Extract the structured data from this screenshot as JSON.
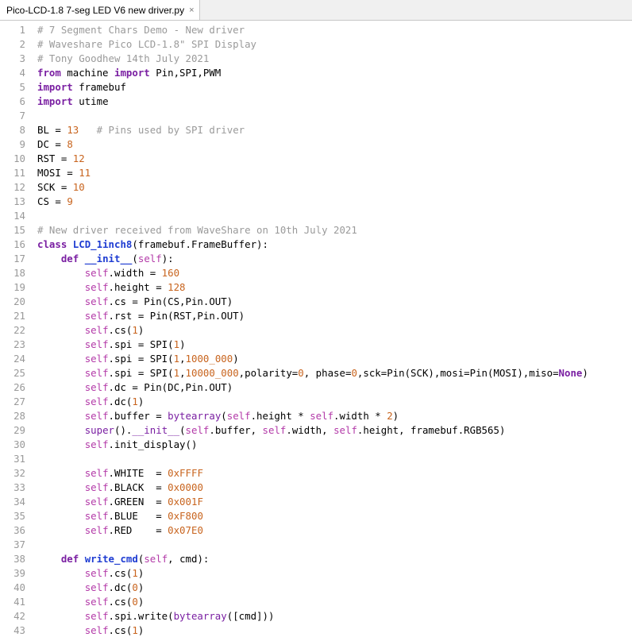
{
  "tab": {
    "title": "Pico-LCD-1.8 7-seg LED V6 new driver.py",
    "close": "×"
  },
  "lines": [
    [
      [
        "c",
        "# 7 Segment Chars Demo - New driver"
      ]
    ],
    [
      [
        "c",
        "# Waveshare Pico LCD-1.8\" SPI Display"
      ]
    ],
    [
      [
        "c",
        "# Tony Goodhew 14th July 2021"
      ]
    ],
    [
      [
        "k",
        "from"
      ],
      [
        "t",
        " machine "
      ],
      [
        "k",
        "import"
      ],
      [
        "t",
        " Pin,SPI,PWM"
      ]
    ],
    [
      [
        "k",
        "import"
      ],
      [
        "t",
        " framebuf"
      ]
    ],
    [
      [
        "k",
        "import"
      ],
      [
        "t",
        " utime"
      ]
    ],
    [],
    [
      [
        "t",
        "BL = "
      ],
      [
        "n",
        "13"
      ],
      [
        "t",
        "   "
      ],
      [
        "c",
        "# Pins used by SPI driver"
      ]
    ],
    [
      [
        "t",
        "DC = "
      ],
      [
        "n",
        "8"
      ]
    ],
    [
      [
        "t",
        "RST = "
      ],
      [
        "n",
        "12"
      ]
    ],
    [
      [
        "t",
        "MOSI = "
      ],
      [
        "n",
        "11"
      ]
    ],
    [
      [
        "t",
        "SCK = "
      ],
      [
        "n",
        "10"
      ]
    ],
    [
      [
        "t",
        "CS = "
      ],
      [
        "n",
        "9"
      ]
    ],
    [],
    [
      [
        "c",
        "# New driver received from WaveShare on 10th July 2021"
      ]
    ],
    [
      [
        "k",
        "class"
      ],
      [
        "t",
        " "
      ],
      [
        "f",
        "LCD_1inch8"
      ],
      [
        "t",
        "(framebuf.FrameBuffer):"
      ]
    ],
    [
      [
        "t",
        "    "
      ],
      [
        "k",
        "def"
      ],
      [
        "t",
        " "
      ],
      [
        "f",
        "__init__"
      ],
      [
        "t",
        "("
      ],
      [
        "s",
        "self"
      ],
      [
        "t",
        "):"
      ]
    ],
    [
      [
        "t",
        "        "
      ],
      [
        "s",
        "self"
      ],
      [
        "t",
        ".width = "
      ],
      [
        "n",
        "160"
      ]
    ],
    [
      [
        "t",
        "        "
      ],
      [
        "s",
        "self"
      ],
      [
        "t",
        ".height = "
      ],
      [
        "n",
        "128"
      ]
    ],
    [
      [
        "t",
        "        "
      ],
      [
        "s",
        "self"
      ],
      [
        "t",
        ".cs = Pin(CS,Pin.OUT)"
      ]
    ],
    [
      [
        "t",
        "        "
      ],
      [
        "s",
        "self"
      ],
      [
        "t",
        ".rst = Pin(RST,Pin.OUT)"
      ]
    ],
    [
      [
        "t",
        "        "
      ],
      [
        "s",
        "self"
      ],
      [
        "t",
        ".cs("
      ],
      [
        "n",
        "1"
      ],
      [
        "t",
        ")"
      ]
    ],
    [
      [
        "t",
        "        "
      ],
      [
        "s",
        "self"
      ],
      [
        "t",
        ".spi = SPI("
      ],
      [
        "n",
        "1"
      ],
      [
        "t",
        ")"
      ]
    ],
    [
      [
        "t",
        "        "
      ],
      [
        "s",
        "self"
      ],
      [
        "t",
        ".spi = SPI("
      ],
      [
        "n",
        "1"
      ],
      [
        "t",
        ","
      ],
      [
        "n",
        "1000_000"
      ],
      [
        "t",
        ")"
      ]
    ],
    [
      [
        "t",
        "        "
      ],
      [
        "s",
        "self"
      ],
      [
        "t",
        ".spi = SPI("
      ],
      [
        "n",
        "1"
      ],
      [
        "t",
        ","
      ],
      [
        "n",
        "10000_000"
      ],
      [
        "t",
        ",polarity="
      ],
      [
        "n",
        "0"
      ],
      [
        "t",
        ", phase="
      ],
      [
        "n",
        "0"
      ],
      [
        "t",
        ",sck=Pin(SCK),mosi=Pin(MOSI),miso="
      ],
      [
        "k",
        "None"
      ],
      [
        "t",
        ")"
      ]
    ],
    [
      [
        "t",
        "        "
      ],
      [
        "s",
        "self"
      ],
      [
        "t",
        ".dc = Pin(DC,Pin.OUT)"
      ]
    ],
    [
      [
        "t",
        "        "
      ],
      [
        "s",
        "self"
      ],
      [
        "t",
        ".dc("
      ],
      [
        "n",
        "1"
      ],
      [
        "t",
        ")"
      ]
    ],
    [
      [
        "t",
        "        "
      ],
      [
        "s",
        "self"
      ],
      [
        "t",
        ".buffer = "
      ],
      [
        "b",
        "bytearray"
      ],
      [
        "t",
        "("
      ],
      [
        "s",
        "self"
      ],
      [
        "t",
        ".height * "
      ],
      [
        "s",
        "self"
      ],
      [
        "t",
        ".width * "
      ],
      [
        "n",
        "2"
      ],
      [
        "t",
        ")"
      ]
    ],
    [
      [
        "t",
        "        "
      ],
      [
        "b",
        "super"
      ],
      [
        "t",
        "()."
      ],
      [
        "b",
        "__init__"
      ],
      [
        "t",
        "("
      ],
      [
        "s",
        "self"
      ],
      [
        "t",
        ".buffer, "
      ],
      [
        "s",
        "self"
      ],
      [
        "t",
        ".width, "
      ],
      [
        "s",
        "self"
      ],
      [
        "t",
        ".height, framebuf.RGB565)"
      ]
    ],
    [
      [
        "t",
        "        "
      ],
      [
        "s",
        "self"
      ],
      [
        "t",
        ".init_display()"
      ]
    ],
    [],
    [
      [
        "t",
        "        "
      ],
      [
        "s",
        "self"
      ],
      [
        "t",
        ".WHITE  = "
      ],
      [
        "n",
        "0xFFFF"
      ]
    ],
    [
      [
        "t",
        "        "
      ],
      [
        "s",
        "self"
      ],
      [
        "t",
        ".BLACK  = "
      ],
      [
        "n",
        "0x0000"
      ]
    ],
    [
      [
        "t",
        "        "
      ],
      [
        "s",
        "self"
      ],
      [
        "t",
        ".GREEN  = "
      ],
      [
        "n",
        "0x001F"
      ]
    ],
    [
      [
        "t",
        "        "
      ],
      [
        "s",
        "self"
      ],
      [
        "t",
        ".BLUE   = "
      ],
      [
        "n",
        "0xF800"
      ]
    ],
    [
      [
        "t",
        "        "
      ],
      [
        "s",
        "self"
      ],
      [
        "t",
        ".RED    = "
      ],
      [
        "n",
        "0x07E0"
      ]
    ],
    [],
    [
      [
        "t",
        "    "
      ],
      [
        "k",
        "def"
      ],
      [
        "t",
        " "
      ],
      [
        "f",
        "write_cmd"
      ],
      [
        "t",
        "("
      ],
      [
        "s",
        "self"
      ],
      [
        "t",
        ", cmd):"
      ]
    ],
    [
      [
        "t",
        "        "
      ],
      [
        "s",
        "self"
      ],
      [
        "t",
        ".cs("
      ],
      [
        "n",
        "1"
      ],
      [
        "t",
        ")"
      ]
    ],
    [
      [
        "t",
        "        "
      ],
      [
        "s",
        "self"
      ],
      [
        "t",
        ".dc("
      ],
      [
        "n",
        "0"
      ],
      [
        "t",
        ")"
      ]
    ],
    [
      [
        "t",
        "        "
      ],
      [
        "s",
        "self"
      ],
      [
        "t",
        ".cs("
      ],
      [
        "n",
        "0"
      ],
      [
        "t",
        ")"
      ]
    ],
    [
      [
        "t",
        "        "
      ],
      [
        "s",
        "self"
      ],
      [
        "t",
        ".spi.write("
      ],
      [
        "b",
        "bytearray"
      ],
      [
        "t",
        "([cmd]))"
      ]
    ],
    [
      [
        "t",
        "        "
      ],
      [
        "s",
        "self"
      ],
      [
        "t",
        ".cs("
      ],
      [
        "n",
        "1"
      ],
      [
        "t",
        ")"
      ]
    ]
  ]
}
